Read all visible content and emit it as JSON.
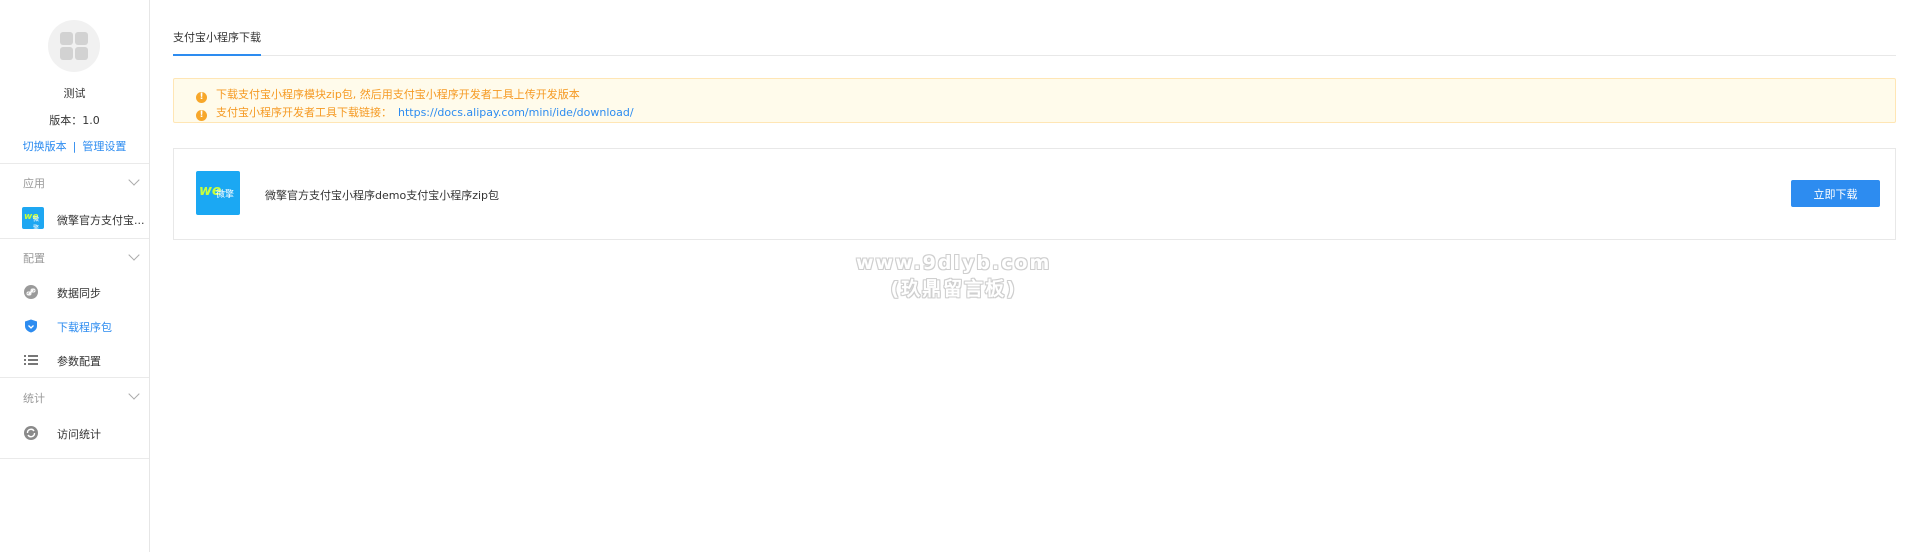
{
  "profile": {
    "name": "测试",
    "version": "版本：1.0",
    "switch_version": "切换版本",
    "separator": "|",
    "manage_settings": "管理设置"
  },
  "sidebar": {
    "sections": [
      {
        "label": "应用",
        "items": [
          {
            "label": "微擎官方支付宝...",
            "icon": "app-logo-icon"
          }
        ]
      },
      {
        "label": "配置",
        "items": [
          {
            "label": "数据同步",
            "icon": "link-icon"
          },
          {
            "label": "下载程序包",
            "icon": "shield-icon",
            "active": true
          },
          {
            "label": "参数配置",
            "icon": "list-icon"
          }
        ]
      },
      {
        "label": "统计",
        "items": [
          {
            "label": "访问统计",
            "icon": "refresh-icon"
          }
        ]
      }
    ]
  },
  "tabs": {
    "active": "支付宝小程序下载"
  },
  "notice": {
    "line1": "下载支付宝小程序模块zip包, 然后用支付宝小程序开发者工具上传开发版本",
    "line2_prefix": "支付宝小程序开发者工具下载链接：",
    "line2_url": "https://docs.alipay.com/mini/ide/download/",
    "icon": "warning-icon",
    "color": "#f59a23"
  },
  "package": {
    "title": "微擎官方支付宝小程序demo支付宝小程序zip包",
    "download_label": "立即下载",
    "logo_text": "we",
    "logo_sub": "微擎"
  },
  "watermark": {
    "line1": "www.9dlyb.com",
    "line2": "(玖鼎留言板)"
  },
  "colors": {
    "accent": "#2d8cf0",
    "warning_bg": "#fffbeb",
    "warning_text": "#f59a23"
  }
}
